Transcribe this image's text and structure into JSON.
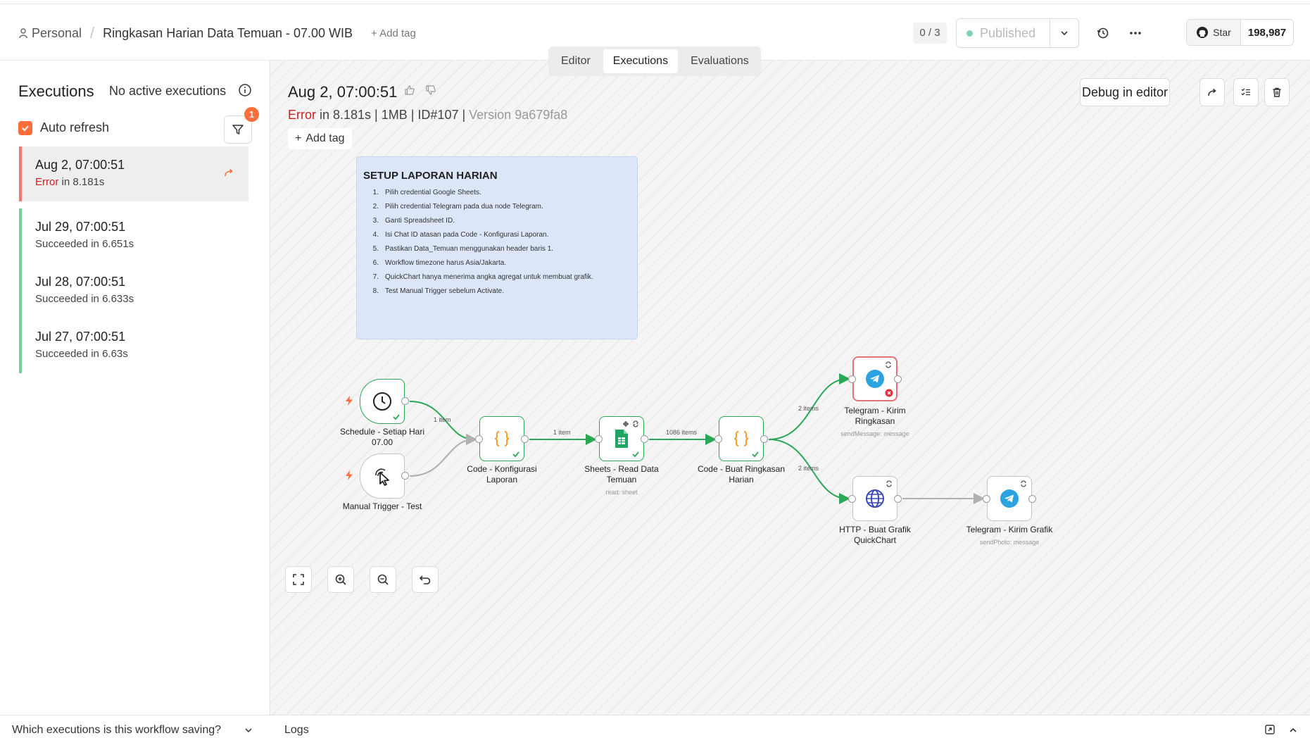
{
  "header": {
    "breadcrumb_project": "Personal",
    "workflow_name": "Ringkasan Harian Data Temuan - 07.00 WIB",
    "add_tag": "+ Add tag",
    "counter": "0 / 3",
    "publish_label": "Published",
    "github_star": "Star",
    "github_count": "198,987"
  },
  "tabs": [
    "Editor",
    "Executions",
    "Evaluations"
  ],
  "sidebar": {
    "title": "Executions",
    "no_active": "No active executions",
    "auto_refresh": "Auto refresh",
    "filter_badge": "1",
    "footer": "Which executions is this workflow saving?",
    "items": [
      {
        "date": "Aug 2, 07:00:51",
        "status_word": "Error",
        "duration": " in 8.181s"
      },
      {
        "date": "Jul 29, 07:00:51",
        "status": "Succeeded in 6.651s"
      },
      {
        "date": "Jul 28, 07:00:51",
        "status": "Succeeded in 6.633s"
      },
      {
        "date": "Jul 27, 07:00:51",
        "status": "Succeeded in 6.63s"
      }
    ]
  },
  "execution": {
    "date": "Aug 2, 07:00:51",
    "status_word": "Error",
    "meta": " in 8.181s | 1MB | ID#107 | ",
    "version": "Version 9a679fa8",
    "add_tag": "Add tag",
    "debug_label": "Debug in editor"
  },
  "sticky": {
    "title": "SETUP LAPORAN HARIAN",
    "items": [
      "Pilih credential Google Sheets.",
      "Pilih credential Telegram pada dua node Telegram.",
      "Ganti Spreadsheet ID.",
      "Isi Chat ID atasan pada Code - Konfigurasi Laporan.",
      "Pastikan Data_Temuan menggunakan header baris 1.",
      "Workflow timezone harus Asia/Jakarta.",
      "QuickChart hanya menerima angka agregat untuk membuat grafik.",
      "Test Manual Trigger sebelum Activate."
    ]
  },
  "nodes": {
    "schedule": "Schedule - Setiap Hari 07.00",
    "manual": "Manual Trigger - Test",
    "code_config": "Code - Konfigurasi Laporan",
    "sheets": "Sheets - Read Data Temuan",
    "sheets_sub": "read: sheet",
    "code_summary": "Code - Buat Ringkasan Harian",
    "tg_summary": "Telegram - Kirim Ringkasan",
    "tg_summary_sub": "sendMessage: message",
    "http": "HTTP - Buat Grafik QuickChart",
    "tg_chart": "Telegram - Kirim Grafik",
    "tg_chart_sub": "sendPhoto: message"
  },
  "edges": {
    "e1": "1 item",
    "e2": "1 item",
    "e3": "1086 items",
    "e4": "2 items",
    "e5": "2 items"
  },
  "logs": {
    "label": "Logs"
  },
  "colors": {
    "accent": "#ff6d3a",
    "success": "#2aa855",
    "error": "#cc1f1f"
  }
}
